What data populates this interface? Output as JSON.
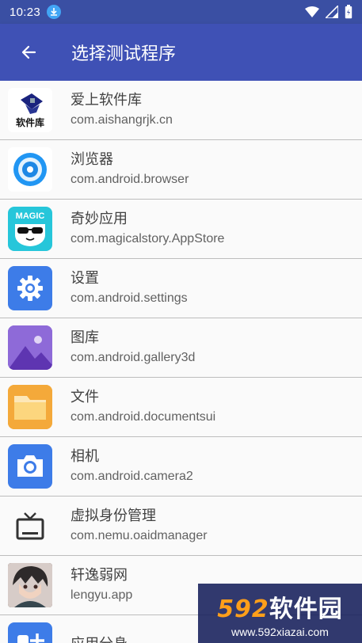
{
  "status": {
    "time": "10:23"
  },
  "header": {
    "title": "选择测试程序"
  },
  "apps": [
    {
      "name": "爱上软件库",
      "package": "com.aishangrjk.cn",
      "icon": "aishang-logo-icon",
      "logo_text": "软件库"
    },
    {
      "name": "浏览器",
      "package": "com.android.browser",
      "icon": "browser-icon"
    },
    {
      "name": "奇妙应用",
      "package": "com.magicalstory.AppStore",
      "icon": "magic-app-icon",
      "logo_text": "MAGIC"
    },
    {
      "name": "设置",
      "package": "com.android.settings",
      "icon": "settings-gear-icon"
    },
    {
      "name": "图库",
      "package": "com.android.gallery3d",
      "icon": "gallery-icon"
    },
    {
      "name": "文件",
      "package": "com.android.documentsui",
      "icon": "folder-icon"
    },
    {
      "name": "相机",
      "package": "com.android.camera2",
      "icon": "camera-icon"
    },
    {
      "name": "虚拟身份管理",
      "package": "com.nemu.oaidmanager",
      "icon": "tv-icon"
    },
    {
      "name": "轩逸弱网",
      "package": "lengyu.app",
      "icon": "avatar-icon"
    },
    {
      "name": "应用分身",
      "package": "",
      "icon": "app-clone-icon"
    }
  ],
  "watermark": {
    "brand_num": "592",
    "brand_text": "软件园",
    "url": "www.592xiazai.com"
  }
}
